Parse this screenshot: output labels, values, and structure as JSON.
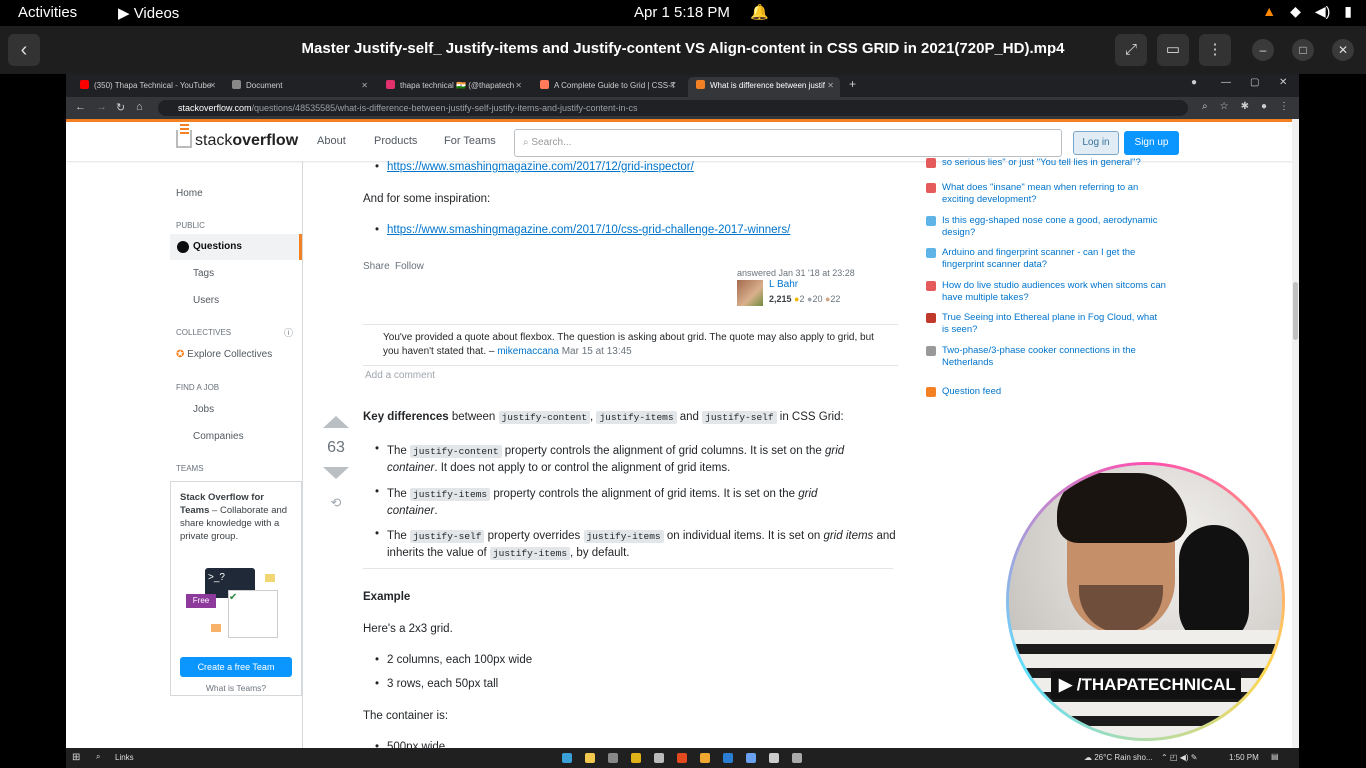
{
  "system_bar": {
    "activities": "Activities",
    "app": "Videos",
    "clock": "Apr 1   5:18 PM"
  },
  "video_window": {
    "title": "Master Justify-self_ Justify-items and Justify-content VS Align-content in CSS GRID in 2021(720P_HD).mp4"
  },
  "browser": {
    "tabs": [
      {
        "label": "(350) Thapa Technical - YouTube",
        "color": "#ff0000"
      },
      {
        "label": "Document",
        "color": "#888888"
      },
      {
        "label": "thapa technical 🇮🇳 (@thapatech",
        "color": "#e1306c"
      },
      {
        "label": "A Complete Guide to Grid | CSS-T",
        "color": "#ff7a59"
      },
      {
        "label": "What is difference between justif",
        "color": "#f48024"
      }
    ],
    "url_domain": "stackoverflow.com",
    "url_path": "/questions/48535585/what-is-difference-between-justify-self-justify-items-and-justify-content-in-cs"
  },
  "header": {
    "logo_light": "stack",
    "logo_bold": "overflow",
    "nav": [
      "About",
      "Products",
      "For Teams"
    ],
    "search_placeholder": "Search...",
    "login": "Log in",
    "signup": "Sign up"
  },
  "leftnav": {
    "home": "Home",
    "public": "PUBLIC",
    "questions": "Questions",
    "tags": "Tags",
    "users": "Users",
    "collectives": "COLLECTIVES",
    "explore": "Explore Collectives",
    "find_job": "FIND A JOB",
    "jobs": "Jobs",
    "companies": "Companies",
    "teams": "TEAMS",
    "team_title": "Stack Overflow for Teams",
    "team_desc": " – Collaborate and share knowledge with a private group.",
    "free": "Free",
    "cta": "Create a free Team",
    "what": "What is Teams?"
  },
  "answer1": {
    "link1": "https://www.smashingmagazine.com/2017/12/grid-inspector/",
    "inspiration": "And for some inspiration:",
    "link2": "https://www.smashingmagazine.com/2017/10/css-grid-challenge-2017-winners/",
    "share": "Share",
    "follow": "Follow",
    "answered": "answered Jan 31 '18 at 23:28",
    "user": "L Bahr",
    "rep": "2,215",
    "gold": "2",
    "silver": "20",
    "bronze": "22"
  },
  "comment": {
    "text": "You've provided a quote about flexbox. The question is asking about grid. The quote may also apply to grid, but you haven't stated that. – ",
    "author": "mikemaccana",
    "date": "Mar 15 at 13:45",
    "add": "Add a comment"
  },
  "answer2": {
    "votes": "63",
    "intro_bold": "Key differences",
    "intro_between": " between ",
    "c1": "justify-content",
    "comma": ", ",
    "c2": "justify-items",
    "and": " and ",
    "c3": "justify-self",
    "intro_end": " in CSS Grid:",
    "b1_pre": "The ",
    "b1_code": "justify-content",
    "b1_mid": " property controls the alignment of grid columns. It is set on the ",
    "b1_em": "grid container",
    "b1_end": ". It does not apply to or control the alignment of grid items.",
    "b2_pre": "The ",
    "b2_code": "justify-items",
    "b2_mid": " property controls the alignment of grid items. It is set on the ",
    "b2_em": "grid container",
    "b2_end": ".",
    "b3_pre": "The ",
    "b3_code": "justify-self",
    "b3_mid": " property overrides ",
    "b3_code2": "justify-items",
    "b3_mid2": " on individual items. It is set on ",
    "b3_em": "grid items",
    "b3_mid3": " and inherits the value of ",
    "b3_code3": "justify-items",
    "b3_end": ", by default.",
    "example": "Example",
    "twobythree": "Here's a 2x3 grid.",
    "li1": "2 columns, each 100px wide",
    "li2": "3 rows, each 50px tall",
    "container": "The container is:",
    "li3": "500px wide"
  },
  "sidebar": {
    "items": [
      {
        "text": "so serious lies\" or just \"You tell lies in general\"?",
        "color": "#e55b5b"
      },
      {
        "text": "What does \"insane\" mean when referring to an exciting development?",
        "color": "#e55b5b"
      },
      {
        "text": "Is this egg-shaped nose cone a good, aerodynamic design?",
        "color": "#5eb4e6"
      },
      {
        "text": "Arduino and fingerprint scanner - can I get the fingerprint scanner data?",
        "color": "#5eb4e6"
      },
      {
        "text": "How do live studio audiences work when sitcoms can have multiple takes?",
        "color": "#e55b5b"
      },
      {
        "text": "True Seeing into Ethereal plane in Fog Cloud, what is seen?",
        "color": "#c0392b"
      },
      {
        "text": "Two-phase/3-phase cooker connections in the Netherlands",
        "color": "#999999"
      }
    ],
    "feed": "Question feed"
  },
  "taskbar": {
    "search": "Links",
    "weather": "26°C  Rain sho...",
    "time": "1:50 PM"
  },
  "overlay": {
    "brand": "▶ /THAPATECHNICAL"
  }
}
